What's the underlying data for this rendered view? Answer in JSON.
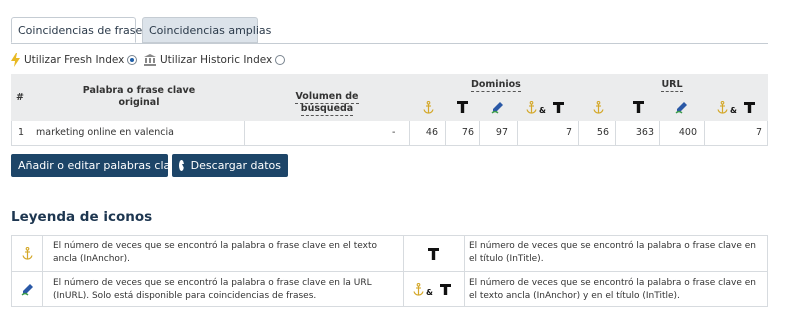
{
  "tabs": {
    "phrase_match": "Coincidencias de frases",
    "broad_match": "Coincidencias amplias"
  },
  "index": {
    "fresh": "Utilizar Fresh Index",
    "historic": "Utilizar Historic Index",
    "selected": "fresh"
  },
  "table": {
    "headers": {
      "hash": "#",
      "keyword": "Palabra o frase clave original",
      "volume": "Volumen de búsqueda",
      "domains": "Dominios",
      "url": "URL"
    },
    "rows": [
      {
        "num": "1",
        "keyword": "marketing online en valencia",
        "volume": "-",
        "dom_anchor": "46",
        "dom_title": "76",
        "dom_url": "97",
        "dom_anchor_title": "7",
        "url_anchor": "56",
        "url_title": "363",
        "url_url": "400",
        "url_anchor_title": "7"
      }
    ]
  },
  "buttons": {
    "add_edit": "Añadir o editar palabras clave",
    "download": "Descargar datos"
  },
  "legend": {
    "title": "Leyenda de iconos",
    "anchor": "El número de veces que se encontró la palabra o frase clave en el texto ancla (InAnchor).",
    "title_desc": "El número de veces que se encontró la palabra o frase clave en el título (InTitle).",
    "url": "El número de veces que se encontró la palabra o frase clave en la URL (InURL). Solo está disponible para coincidencias de frases.",
    "anchor_title": "El número de veces que se encontró la palabra o frase clave en el texto ancla (InAnchor) y en el título (InTitle)."
  },
  "icons": {
    "anchor": "anchor-icon",
    "title": "title-T-icon",
    "url": "url-pen-icon",
    "fresh": "lightning-icon",
    "historic": "museum-icon",
    "download": "download-circle-icon"
  },
  "colors": {
    "anchor": "#d4a82a",
    "navy": "#1d4568",
    "url_blue": "#2a58a6",
    "url_green": "#3a9a4a",
    "header_bg": "#ebeced"
  }
}
